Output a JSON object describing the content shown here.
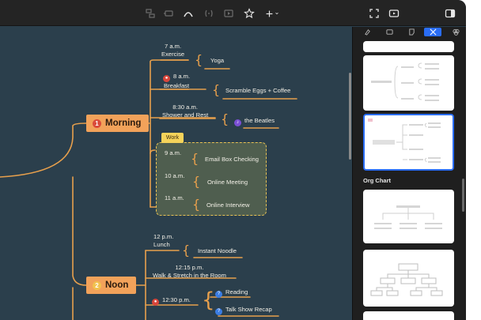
{
  "toolbar": {
    "icons_center": [
      "subtopic-icon",
      "floating-icon",
      "relationship-icon",
      "boundary-icon",
      "summary-icon",
      "star-icon",
      "insert-icon"
    ],
    "insert_caret": "⌄",
    "icons_right": [
      "fullscreen-icon",
      "presentation-icon",
      "sidebar-toggle-icon"
    ]
  },
  "mindmap": {
    "morning": {
      "num": "1",
      "label": "Morning"
    },
    "noon": {
      "num": "2",
      "label": "Noon"
    },
    "work_tag": "Work",
    "items": {
      "t7": "7 a.m.",
      "exercise": "Exercise",
      "yoga": "Yoga",
      "t8": "8 a.m.",
      "breakfast": "Breakfast",
      "scramble": "Scramble Eggs + Coffee",
      "t830": "8:30 a.m.",
      "shower": "Shower and Rest",
      "beatles": "the Beatles",
      "t9": "9 a.m.",
      "email": "Email Box Checking",
      "t10": "10 a.m.",
      "online_meeting": "Online Meeting",
      "t11": "11 a.m.",
      "online_interview": "Online Interview",
      "t12": "12 p.m.",
      "lunch": "Lunch",
      "noodle": "Instant Noodle",
      "t1215": "12:15 p.m.",
      "walk": "Walk & Stretch in the Room",
      "t1230": "12:30 p.m.",
      "reading": "Reading",
      "talkshow": "Talk Show Recap"
    }
  },
  "panel": {
    "tabs": [
      "style-icon",
      "format-icon",
      "notes-icon",
      "structure-icon",
      "theme-icon"
    ],
    "active_tab": "structure-icon",
    "section_title": "Org Chart"
  },
  "colors": {
    "canvas": "#2b3f4c",
    "topic": "#f2a25a",
    "branch": "#e8a04c",
    "work_fill": "#4f5e4f",
    "work_tag": "#f5d35a",
    "accent": "#2a6df5"
  }
}
